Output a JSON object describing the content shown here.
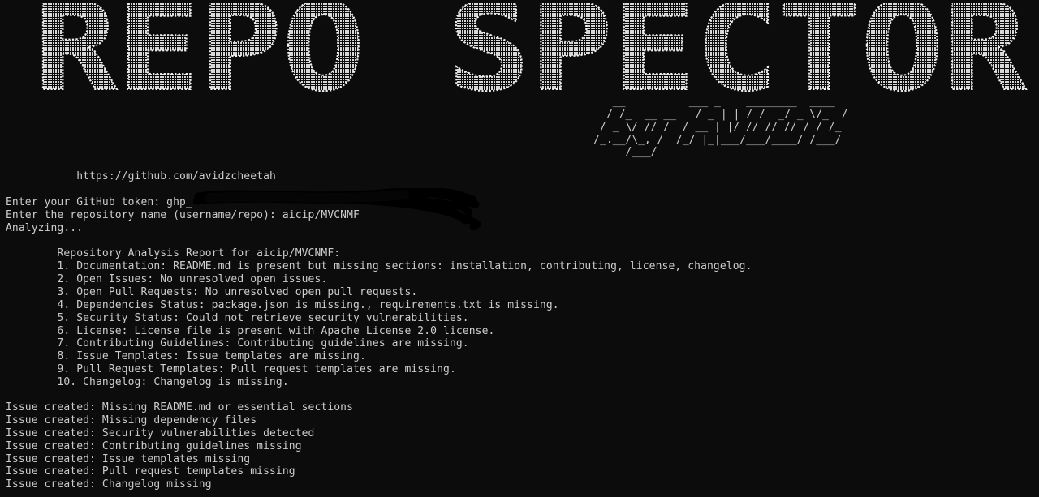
{
  "banner": {
    "title": "REPO SPECTOR",
    "subtitle_art": [
      "       __          ___ _    ________  ____",
      "      / /_  __ __   / _ | | / /  _/ _ \\/_  /",
      "     / _ \\/ // /  / __ | |/ // // // / / /_",
      "    /_.__/\\_, /  /_/ |_|___/___/____/ /___/",
      "         /___/"
    ]
  },
  "link": "           https://github.com/avidzcheetah",
  "prompts": {
    "token_prompt": "Enter your GitHub token: ghp_",
    "repo_prompt": "Enter the repository name (username/repo): aicip/MVCNMF",
    "status": "Analyzing..."
  },
  "report": {
    "heading": "        Repository Analysis Report for aicip/MVCNMF:",
    "items": [
      "        1. Documentation: README.md is present but missing sections: installation, contributing, license, changelog.",
      "        2. Open Issues: No unresolved open issues.",
      "        3. Open Pull Requests: No unresolved open pull requests.",
      "        4. Dependencies Status: package.json is missing., requirements.txt is missing.",
      "        5. Security Status: Could not retrieve security vulnerabilities.",
      "        6. License: License file is present with Apache License 2.0 license.",
      "        7. Contributing Guidelines: Contributing guidelines are missing.",
      "        8. Issue Templates: Issue templates are missing.",
      "        9. Pull Request Templates: Pull request templates are missing.",
      "        10. Changelog: Changelog is missing."
    ]
  },
  "issues": [
    "Issue created: Missing README.md or essential sections",
    "Issue created: Missing dependency files",
    "Issue created: Security vulnerabilities detected",
    "Issue created: Contributing guidelines missing",
    "Issue created: Issue templates missing",
    "Issue created: Pull request templates missing",
    "Issue created: Changelog missing"
  ],
  "colors": {
    "background": "#0c0c0c",
    "text": "#cccccc",
    "banner": "#e6e6e6"
  }
}
